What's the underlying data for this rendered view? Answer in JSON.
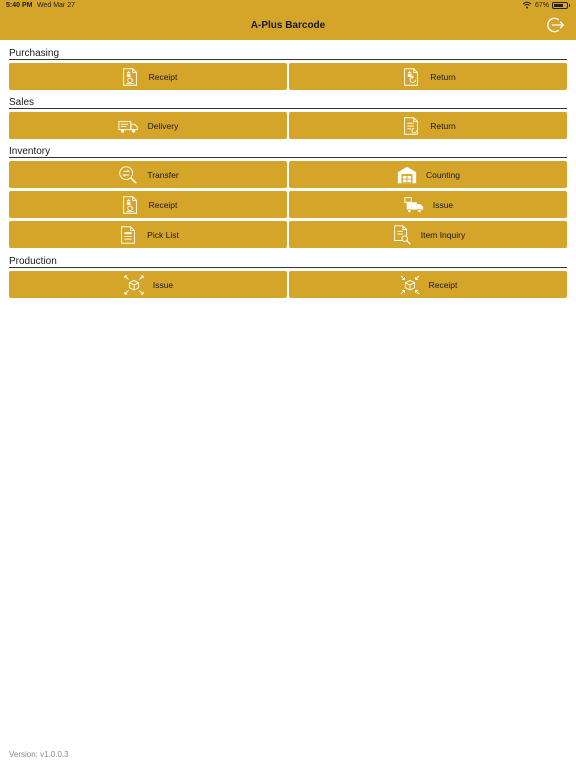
{
  "status": {
    "time": "5:40 PM",
    "date": "Wed Mar 27",
    "battery": "67%"
  },
  "header": {
    "title": "A-Plus Barcode",
    "logout_icon": "logout-icon"
  },
  "sections": {
    "purchasing": {
      "title": "Purchasing",
      "tiles": [
        {
          "label": "Receipt",
          "icon": "receipt-doc-icon"
        },
        {
          "label": "Return",
          "icon": "return-doc-icon"
        }
      ]
    },
    "sales": {
      "title": "Sales",
      "tiles": [
        {
          "label": "Delivery",
          "icon": "delivery-truck-icon"
        },
        {
          "label": "Return",
          "icon": "return-doc-icon"
        }
      ]
    },
    "inventory": {
      "title": "Inventory",
      "tiles": [
        {
          "label": "Transfer",
          "icon": "transfer-icon"
        },
        {
          "label": "Counting",
          "icon": "warehouse-icon"
        },
        {
          "label": "Receipt",
          "icon": "receipt-doc-icon"
        },
        {
          "label": "Issue",
          "icon": "issue-truck-icon"
        },
        {
          "label": "Pick List",
          "icon": "pick-list-icon"
        },
        {
          "label": "Item Inquiry",
          "icon": "item-inquiry-icon"
        }
      ]
    },
    "production": {
      "title": "Production",
      "tiles": [
        {
          "label": "Issue",
          "icon": "box-expand-icon"
        },
        {
          "label": "Receipt",
          "icon": "box-collapse-icon"
        }
      ]
    }
  },
  "version": "Version: v1.0.0.3",
  "colors": {
    "accent": "#D4A528",
    "text": "#1a1a1a",
    "muted": "#8a8a8a"
  }
}
